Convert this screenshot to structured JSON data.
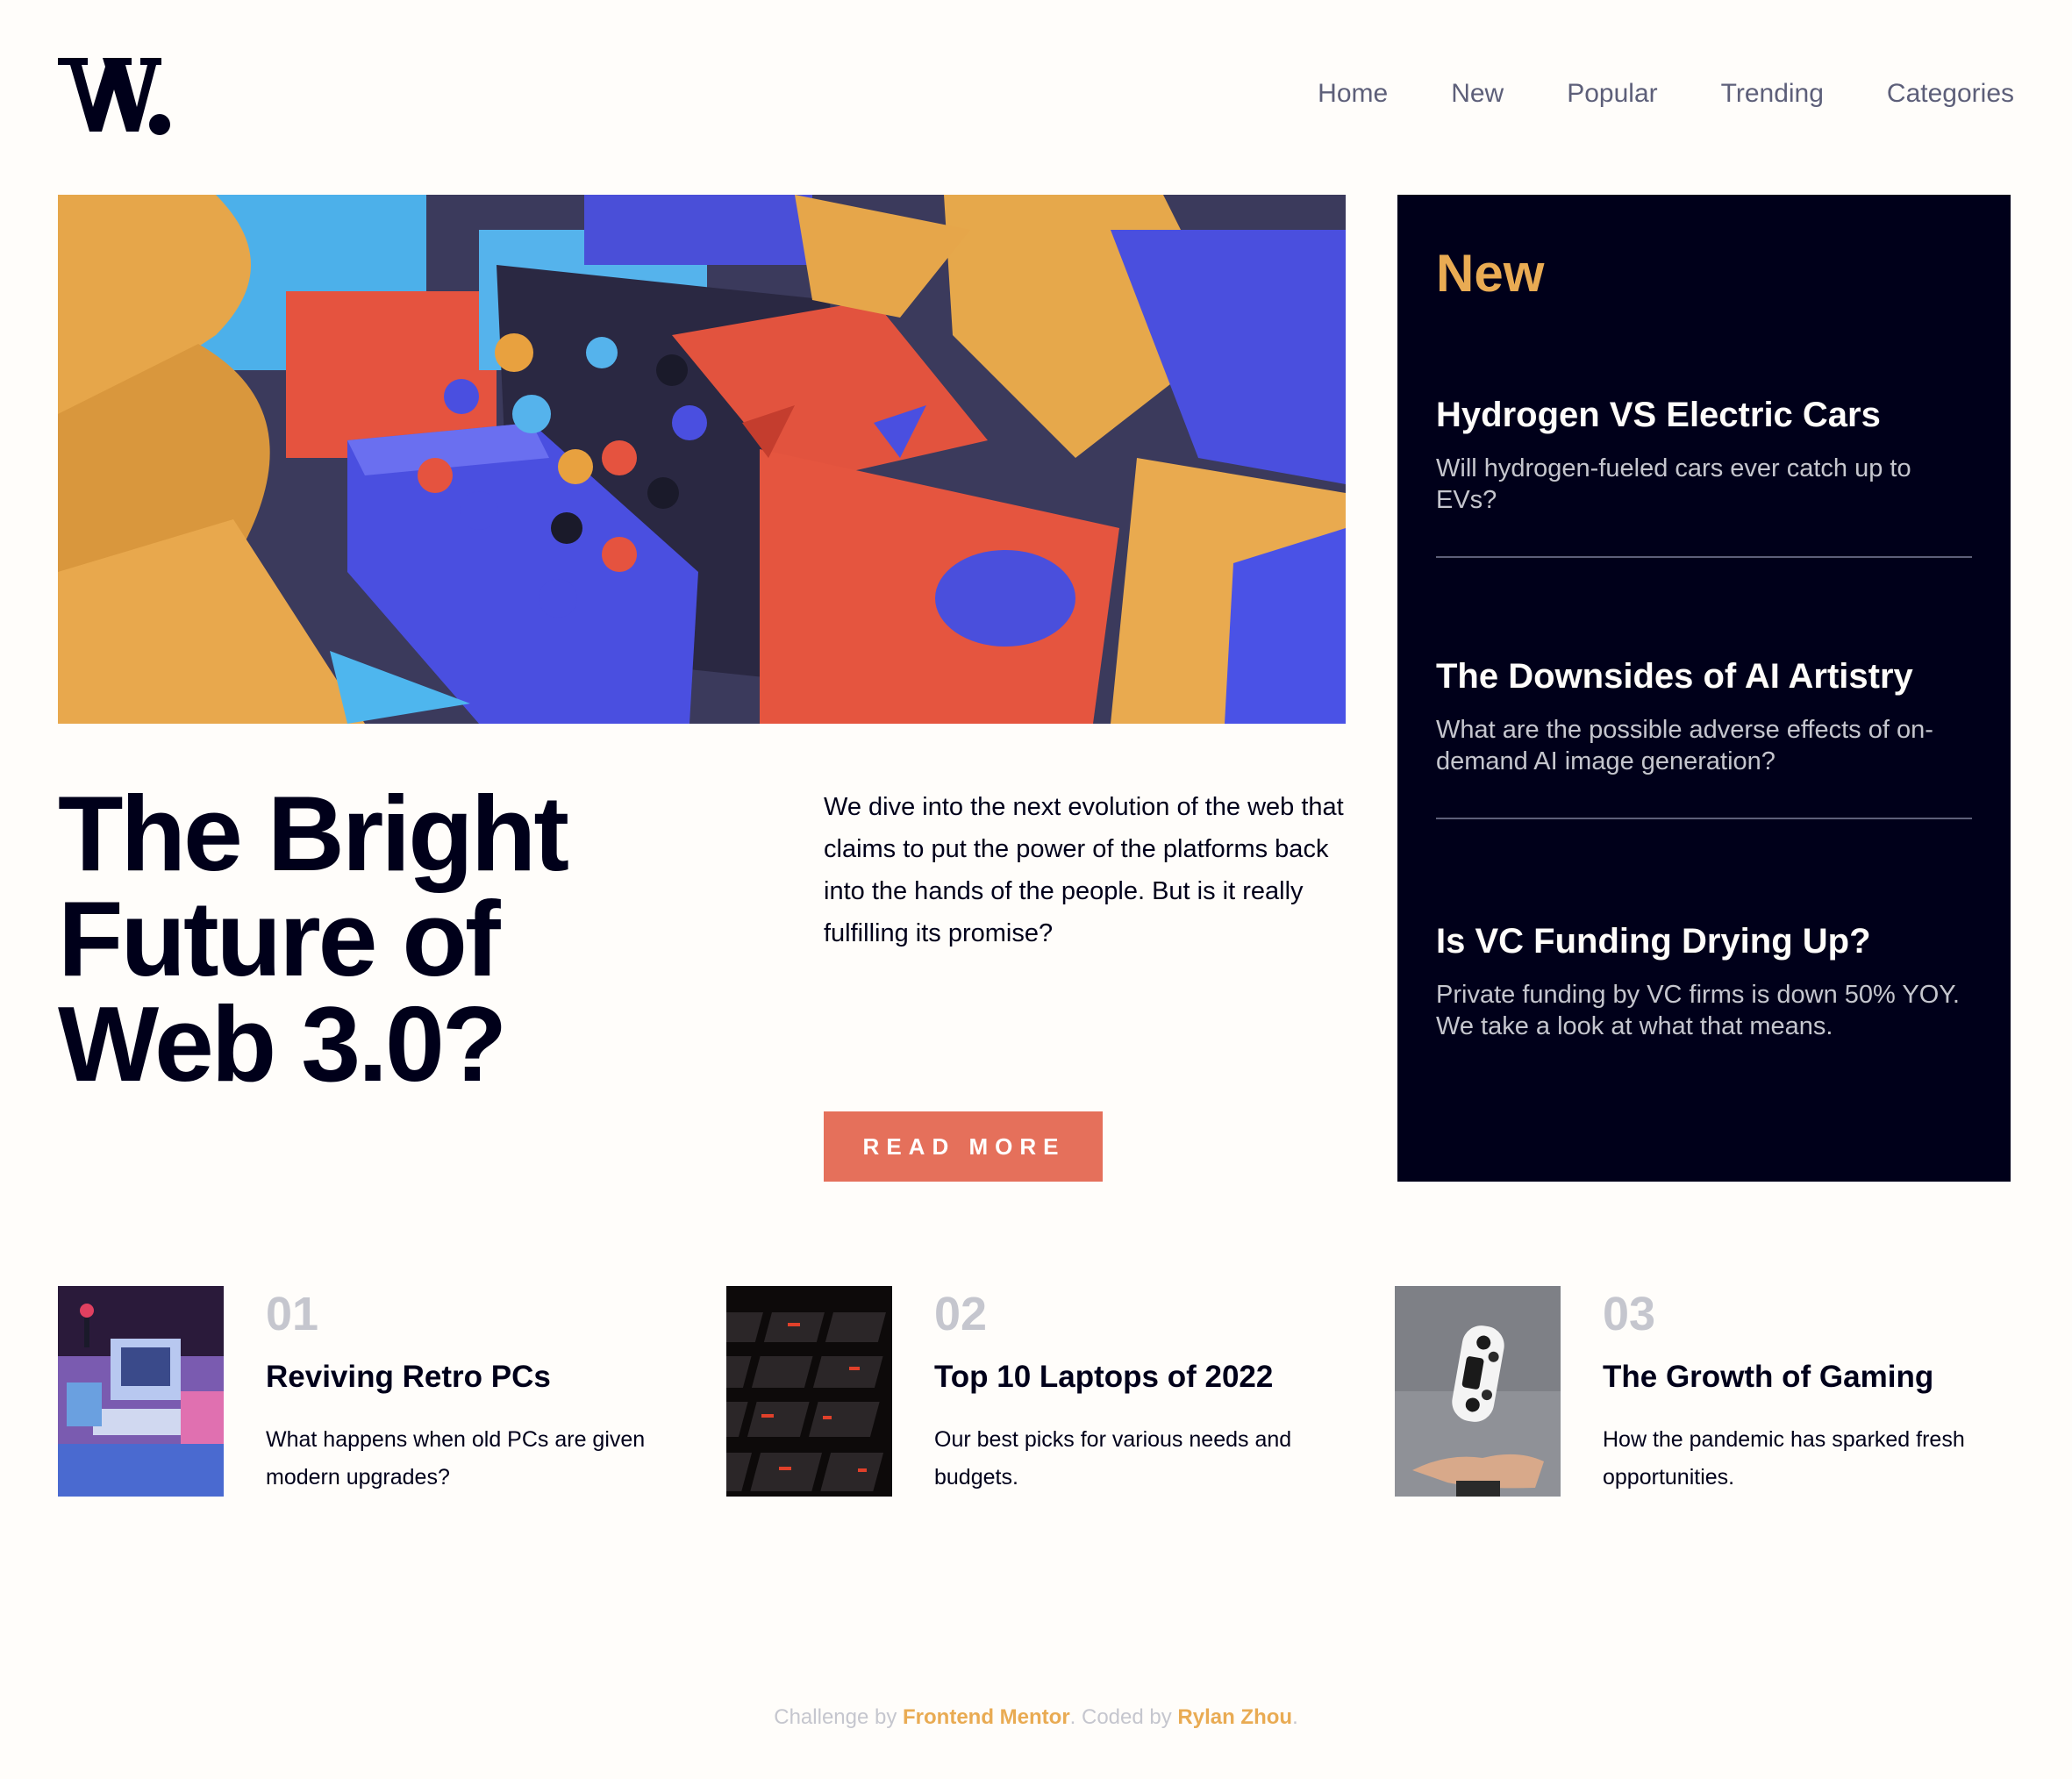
{
  "header": {
    "logo_alt": "W.",
    "nav": [
      "Home",
      "New",
      "Popular",
      "Trending",
      "Categories"
    ]
  },
  "hero": {
    "image_icon": "abstract-3d-blocks-image",
    "title": "The Bright Future of Web 3.0?",
    "description": "We dive into the next evolution of the web that claims to put the power of the platforms back into the hands of the people. But is it really fulfilling its promise?",
    "cta": "READ MORE"
  },
  "new_panel": {
    "heading": "New",
    "items": [
      {
        "title": "Hydrogen VS Electric Cars",
        "desc": "Will hydrogen-fueled cars ever catch up to EVs?"
      },
      {
        "title": "The Downsides of AI Artistry",
        "desc": "What are the possible adverse effects of on-demand AI image generation?"
      },
      {
        "title": "Is VC Funding Drying Up?",
        "desc": "Private funding by VC firms is down 50% YOY. We take a look at what that means."
      }
    ]
  },
  "articles": [
    {
      "num": "01",
      "title": "Reviving Retro PCs",
      "desc": "What happens when old PCs are given modern upgrades?",
      "image_icon": "retro-pc-image"
    },
    {
      "num": "02",
      "title": "Top 10 Laptops of 2022",
      "desc": "Our best picks for various needs and budgets.",
      "image_icon": "laptop-keyboard-image"
    },
    {
      "num": "03",
      "title": "The Growth of Gaming",
      "desc": "How the pandemic has sparked fresh opportunities.",
      "image_icon": "gamepad-image"
    }
  ],
  "footer": {
    "prefix": "Challenge by ",
    "link1": "Frontend Mentor",
    "middle": ". Coded by ",
    "link2": "Rylan Zhou",
    "suffix": "."
  },
  "colors": {
    "background": "#fffdfa",
    "dark": "#00001a",
    "accent_red": "#e5705b",
    "accent_gold": "#e9ab53",
    "grey": "#5d5f79",
    "light_grey": "#c5c6ce"
  }
}
